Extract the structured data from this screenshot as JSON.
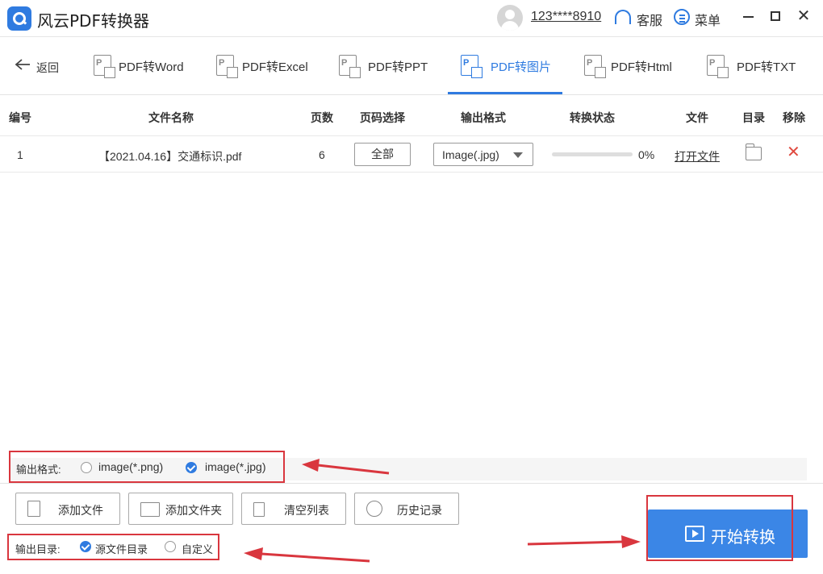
{
  "app": {
    "title": "风云PDF转换器",
    "username": "123****8910",
    "service_label": "客服",
    "menu_label": "菜单"
  },
  "nav": {
    "back_label": "返回",
    "tabs": [
      {
        "label": "PDF转Word",
        "icon": "pdf-word-icon",
        "active": false
      },
      {
        "label": "PDF转Excel",
        "icon": "pdf-excel-icon",
        "active": false
      },
      {
        "label": "PDF转PPT",
        "icon": "pdf-ppt-icon",
        "active": false
      },
      {
        "label": "PDF转图片",
        "icon": "pdf-image-icon",
        "active": true
      },
      {
        "label": "PDF转Html",
        "icon": "pdf-html-icon",
        "active": false
      },
      {
        "label": "PDF转TXT",
        "icon": "pdf-txt-icon",
        "active": false
      }
    ]
  },
  "table": {
    "columns": [
      "编号",
      "文件名称",
      "页数",
      "页码选择",
      "输出格式",
      "转换状态",
      "文件",
      "目录",
      "移除"
    ],
    "rows": [
      {
        "index": "1",
        "filename": "【2021.04.16】交通标识.pdf",
        "pages": "6",
        "page_select": "全部",
        "output_format": "Image(.jpg)",
        "progress_percent": 0,
        "progress_label": "0%",
        "open_file": "打开文件"
      }
    ]
  },
  "output_format": {
    "label": "输出格式:",
    "options": [
      {
        "label": "image(*.png)",
        "checked": false
      },
      {
        "label": "image(*.jpg)",
        "checked": true
      }
    ]
  },
  "toolbar": {
    "add_file": "添加文件",
    "add_folder": "添加文件夹",
    "clear_list": "清空列表",
    "history": "历史记录"
  },
  "output_dir": {
    "label": "输出目录:",
    "options": [
      {
        "label": "源文件目录",
        "checked": true
      },
      {
        "label": "自定义",
        "checked": false
      }
    ]
  },
  "start_button": {
    "label": "开始转换"
  },
  "colors": {
    "accent": "#2f7be0",
    "annotation_red": "#d9363e",
    "remove_red": "#e04a3f"
  }
}
